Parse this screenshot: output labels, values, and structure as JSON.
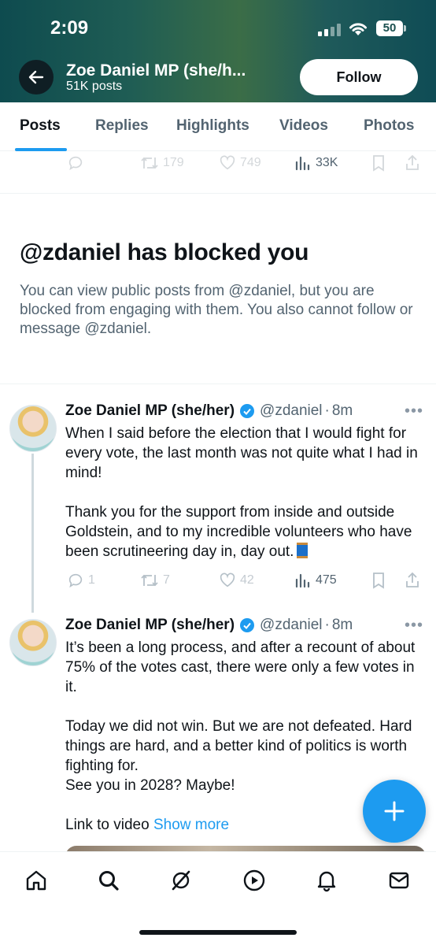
{
  "status_bar": {
    "time": "2:09",
    "battery": "50"
  },
  "header": {
    "name": "Zoe Daniel MP (she/h...",
    "post_count": "51K posts",
    "follow_label": "Follow"
  },
  "tabs": [
    {
      "label": "Posts",
      "active": true
    },
    {
      "label": "Replies"
    },
    {
      "label": "Highlights"
    },
    {
      "label": "Videos"
    },
    {
      "label": "Photos"
    }
  ],
  "prev_tweet_actions": {
    "retweets": "179",
    "likes": "749",
    "views": "33K"
  },
  "blocked_notice": {
    "title": "@zdaniel has blocked you",
    "body": "You can view public posts from @zdaniel, but you are blocked from engaging with them. You also cannot follow or message @zdaniel."
  },
  "tweets": [
    {
      "name": "Zoe Daniel MP (she/her)",
      "handle": "@zdaniel",
      "dot": "·",
      "time": "8m",
      "text": "When I said before the election that I would fight for every vote, the last month was not quite what I had in mind!\n\nThank you for the support from inside and outside Goldstein, and to my incredible volunteers who have been scrutineering day in, day out.",
      "replies": "1",
      "retweets": "7",
      "likes": "42",
      "views": "475"
    },
    {
      "name": "Zoe Daniel MP (she/her)",
      "handle": "@zdaniel",
      "dot": "·",
      "time": "8m",
      "text": "It’s been a long process, and after a recount of about 75% of the votes cast, there were only a few votes in it.\n\nToday we did not win. But we are not defeated. Hard things are hard, and a better kind of politics is worth fighting for.\nSee you in 2028? Maybe!\n\nLink to video ",
      "show_more": "Show more"
    }
  ],
  "colors": {
    "accent": "#1d9bf0",
    "text": "#0f1419",
    "secondary": "#536471"
  },
  "icons": [
    "back-arrow-icon",
    "verified-icon",
    "reply-icon",
    "retweet-icon",
    "like-icon",
    "views-icon",
    "bookmark-icon",
    "share-icon",
    "home-icon",
    "search-icon",
    "grok-icon",
    "play-icon",
    "notifications-icon",
    "messages-icon",
    "compose-icon"
  ]
}
